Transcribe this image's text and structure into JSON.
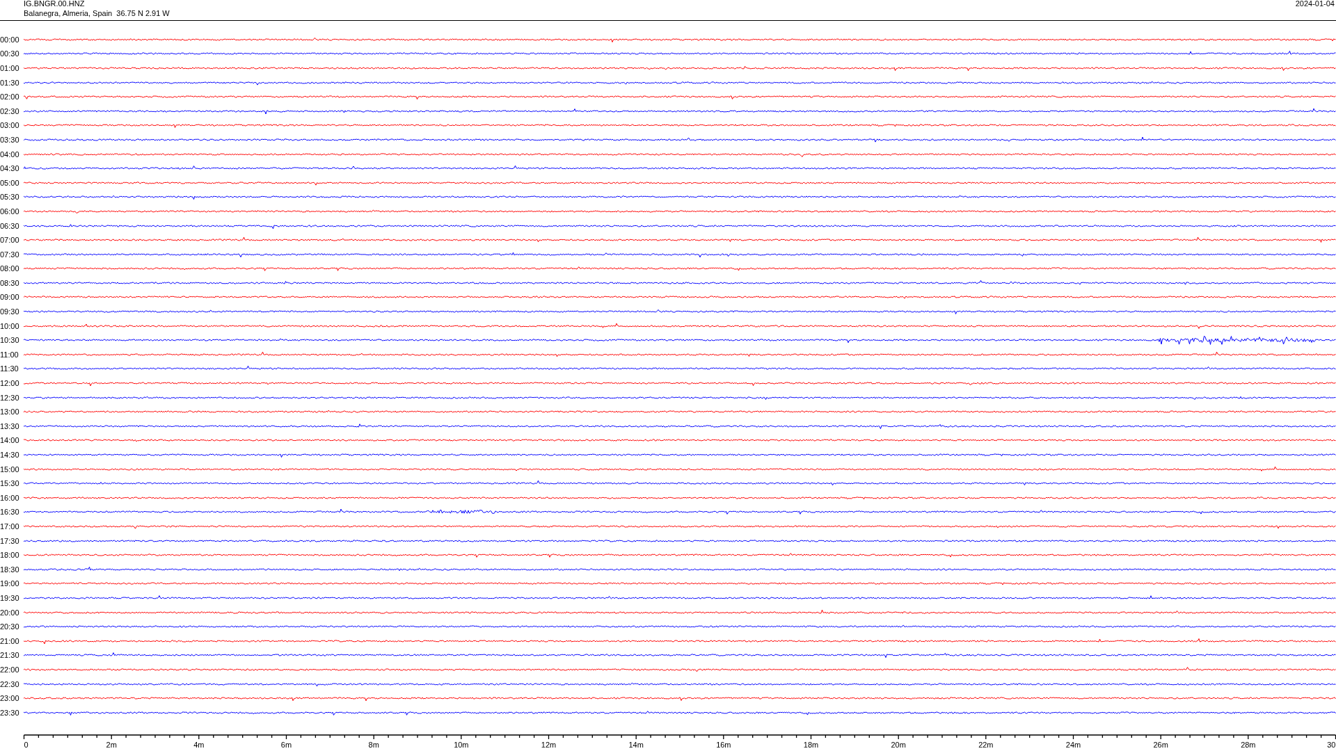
{
  "header": {
    "station": "IG.BNGR.00.HNZ",
    "location": "Balanegra, Almeria, Spain  36.75 N 2.91 W",
    "date": "2024-01-04"
  },
  "traces": [
    {
      "time": "00:00",
      "color": "#ff0000"
    },
    {
      "time": "00:30",
      "color": "#0000ff"
    },
    {
      "time": "01:00",
      "color": "#ff0000"
    },
    {
      "time": "01:30",
      "color": "#0000ff"
    },
    {
      "time": "02:00",
      "color": "#ff0000"
    },
    {
      "time": "02:30",
      "color": "#0000ff"
    },
    {
      "time": "03:00",
      "color": "#ff0000"
    },
    {
      "time": "03:30",
      "color": "#0000ff"
    },
    {
      "time": "04:00",
      "color": "#ff0000"
    },
    {
      "time": "04:30",
      "color": "#0000ff"
    },
    {
      "time": "05:00",
      "color": "#ff0000"
    },
    {
      "time": "05:30",
      "color": "#0000ff"
    },
    {
      "time": "06:00",
      "color": "#ff0000"
    },
    {
      "time": "06:30",
      "color": "#0000ff"
    },
    {
      "time": "07:00",
      "color": "#ff0000"
    },
    {
      "time": "07:30",
      "color": "#0000ff"
    },
    {
      "time": "08:00",
      "color": "#ff0000"
    },
    {
      "time": "08:30",
      "color": "#0000ff"
    },
    {
      "time": "09:00",
      "color": "#ff0000"
    },
    {
      "time": "09:30",
      "color": "#0000ff"
    },
    {
      "time": "10:00",
      "color": "#ff0000"
    },
    {
      "time": "10:30",
      "color": "#0000ff"
    },
    {
      "time": "11:00",
      "color": "#ff0000"
    },
    {
      "time": "11:30",
      "color": "#0000ff"
    },
    {
      "time": "12:00",
      "color": "#ff0000"
    },
    {
      "time": "12:30",
      "color": "#0000ff"
    },
    {
      "time": "13:00",
      "color": "#ff0000"
    },
    {
      "time": "13:30",
      "color": "#0000ff"
    },
    {
      "time": "14:00",
      "color": "#ff0000"
    },
    {
      "time": "14:30",
      "color": "#0000ff"
    },
    {
      "time": "15:00",
      "color": "#ff0000"
    },
    {
      "time": "15:30",
      "color": "#0000ff"
    },
    {
      "time": "16:00",
      "color": "#ff0000"
    },
    {
      "time": "16:30",
      "color": "#0000ff"
    },
    {
      "time": "17:00",
      "color": "#ff0000"
    },
    {
      "time": "17:30",
      "color": "#0000ff"
    },
    {
      "time": "18:00",
      "color": "#ff0000"
    },
    {
      "time": "18:30",
      "color": "#0000ff"
    },
    {
      "time": "19:00",
      "color": "#ff0000"
    },
    {
      "time": "19:30",
      "color": "#0000ff"
    },
    {
      "time": "20:00",
      "color": "#ff0000"
    },
    {
      "time": "20:30",
      "color": "#0000ff"
    },
    {
      "time": "21:00",
      "color": "#ff0000"
    },
    {
      "time": "21:30",
      "color": "#0000ff"
    },
    {
      "time": "22:00",
      "color": "#ff0000"
    },
    {
      "time": "22:30",
      "color": "#0000ff"
    },
    {
      "time": "23:00",
      "color": "#ff0000"
    },
    {
      "time": "23:30",
      "color": "#0000ff"
    }
  ],
  "axis": {
    "tick_labels": [
      "0",
      "2m",
      "4m",
      "6m",
      "8m",
      "10m",
      "12m",
      "14m",
      "16m",
      "18m",
      "20m",
      "22m",
      "24m",
      "26m",
      "28m",
      "30"
    ]
  }
}
